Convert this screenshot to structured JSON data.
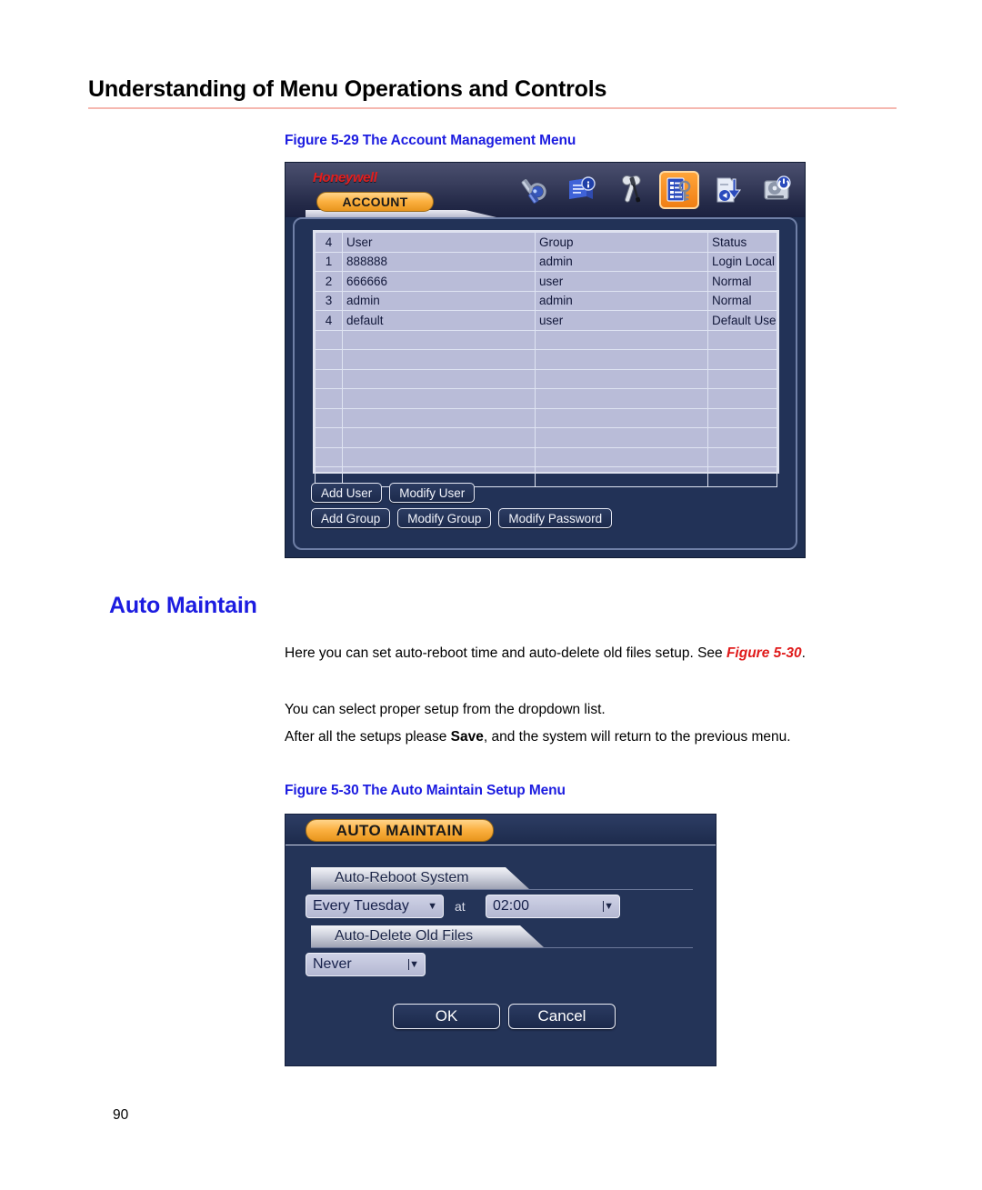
{
  "page": {
    "heading": "Understanding of Menu Operations and Controls",
    "number": "90"
  },
  "figure_529": {
    "caption": "Figure 5-29 The Account Management Menu",
    "window": {
      "brand": "Honeywell",
      "active_tab": "ACCOUNT",
      "toolbar_icons": [
        "search-icon",
        "info-book-icon",
        "tools-icon",
        "account-icon",
        "backup-icon",
        "hdd-icon"
      ],
      "table": {
        "headers": [
          "4",
          "User",
          "Group",
          "Status"
        ],
        "rows": [
          [
            "1",
            "888888",
            "admin",
            "Login Local"
          ],
          [
            "2",
            "666666",
            "user",
            "Normal"
          ],
          [
            "3",
            "admin",
            "admin",
            "Normal"
          ],
          [
            "4",
            "default",
            "user",
            "Default User"
          ]
        ],
        "empty_row_count": 8
      },
      "buttons_row1": [
        "Add User",
        "Modify User"
      ],
      "buttons_row2": [
        "Add Group",
        "Modify Group",
        "Modify Password"
      ]
    }
  },
  "auto_maintain": {
    "section_title": "Auto Maintain",
    "paragraph1_a": "Here you can set auto-reboot time and auto-delete old files setup. See ",
    "paragraph1_figref": "Figure 5-30",
    "paragraph1_b": ".",
    "paragraph2": "You can select proper setup from the dropdown list.",
    "paragraph3_a": "After all the setups please ",
    "paragraph3_bold": "Save",
    "paragraph3_b": ", and the system will return to the previous menu."
  },
  "figure_530": {
    "caption": "Figure 5-30 The Auto Maintain Setup Menu",
    "window": {
      "title": "AUTO MAINTAIN",
      "reboot_section_label": "Auto-Reboot System",
      "reboot_day_value": "Every Tuesday",
      "at_label": "at",
      "reboot_time_value": "02:00",
      "delete_section_label": "Auto-Delete Old Files",
      "delete_value": "Never",
      "ok_label": "OK",
      "cancel_label": "Cancel"
    }
  },
  "colors": {
    "heading_rule": "#f5b8b0",
    "caption_blue": "#1c1ce0",
    "figref_red": "#e01b1b",
    "brand_red": "#e21e1e",
    "tab_orange": "#fbb040",
    "window_navy": "#243458",
    "grid_lavender": "#b9bcd8"
  }
}
